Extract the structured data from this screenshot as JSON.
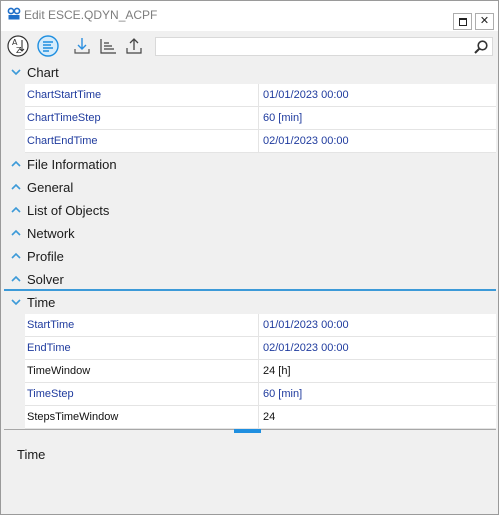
{
  "window": {
    "title": "Edit ESCE.QDYN_ACPF",
    "icon": "app-icon",
    "buttons": {
      "restore": "restore-icon",
      "close": "✕"
    }
  },
  "toolbar": {
    "tools": [
      "sort-alphabetical-icon",
      "sort-categorized-icon",
      "import-icon",
      "outline-icon",
      "export-icon"
    ],
    "search": {
      "value": "",
      "placeholder": "",
      "icon": "search-icon"
    }
  },
  "categories": [
    {
      "label": "Chart",
      "expanded": true,
      "properties": [
        {
          "name": "ChartStartTime",
          "value": "01/01/2023 00:00",
          "modified": true
        },
        {
          "name": "ChartTimeStep",
          "value": "60 [min]",
          "modified": true
        },
        {
          "name": "ChartEndTime",
          "value": "02/01/2023 00:00",
          "modified": true
        }
      ]
    },
    {
      "label": "File Information",
      "expanded": false,
      "properties": []
    },
    {
      "label": "General",
      "expanded": false,
      "properties": []
    },
    {
      "label": "List of Objects",
      "expanded": false,
      "properties": []
    },
    {
      "label": "Network",
      "expanded": false,
      "properties": []
    },
    {
      "label": "Profile",
      "expanded": false,
      "properties": []
    },
    {
      "label": "Solver",
      "expanded": false,
      "properties": []
    },
    {
      "label": "Time",
      "expanded": true,
      "selected": true,
      "properties": [
        {
          "name": "StartTime",
          "value": "01/01/2023 00:00",
          "modified": true
        },
        {
          "name": "EndTime",
          "value": "02/01/2023 00:00",
          "modified": true
        },
        {
          "name": "TimeWindow",
          "value": "24 [h]",
          "modified": false
        },
        {
          "name": "TimeStep",
          "value": "60 [min]",
          "modified": true
        },
        {
          "name": "StepsTimeWindow",
          "value": "24",
          "modified": false
        }
      ]
    }
  ],
  "help": {
    "title": "Time"
  },
  "colors": {
    "accent": "#3c9ad8",
    "modified_text": "#1f3b9e",
    "title_text": "#7d7d7d"
  }
}
